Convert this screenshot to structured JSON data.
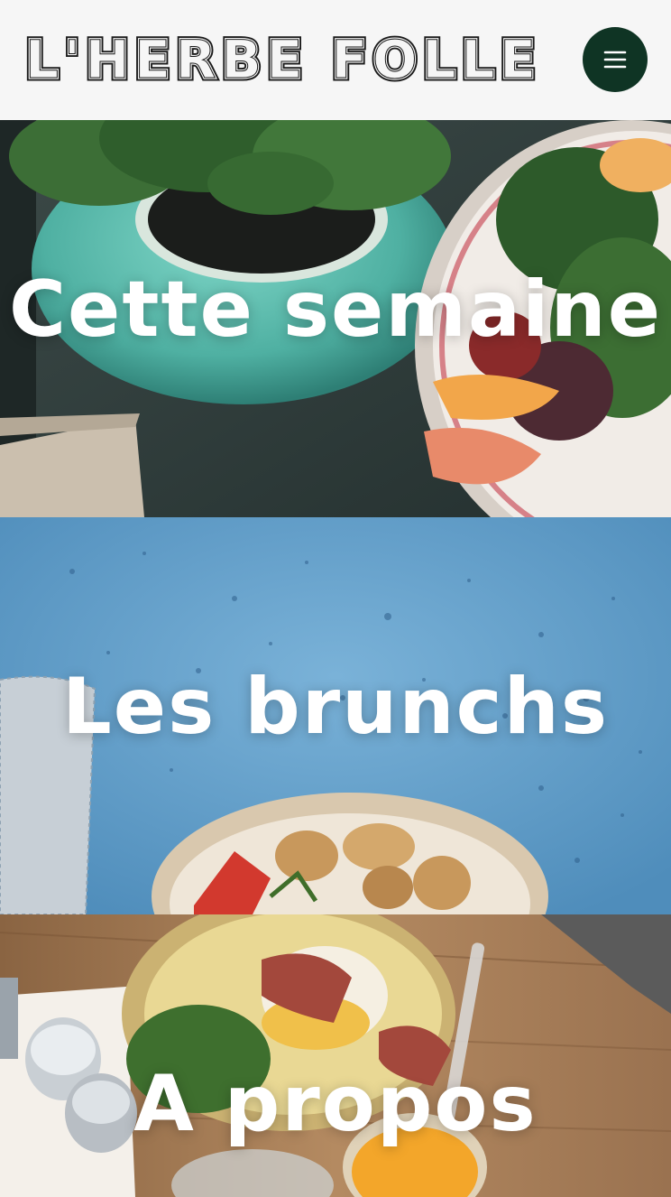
{
  "header": {
    "logo_text": "L'HERBE FOLLE",
    "menu_icon": "hamburger-menu-icon"
  },
  "colors": {
    "header_bg": "#f6f6f6",
    "menu_button_bg": "#0f3424",
    "title_text": "#ffffff"
  },
  "panels": [
    {
      "title": "Cette semaine",
      "image": "plant-pot-and-salad-plate"
    },
    {
      "title": "Les brunchs",
      "image": "blue-table-with-mushroom-bowl"
    },
    {
      "title": "A propos",
      "image": "brunch-plate-on-wooden-table"
    }
  ]
}
